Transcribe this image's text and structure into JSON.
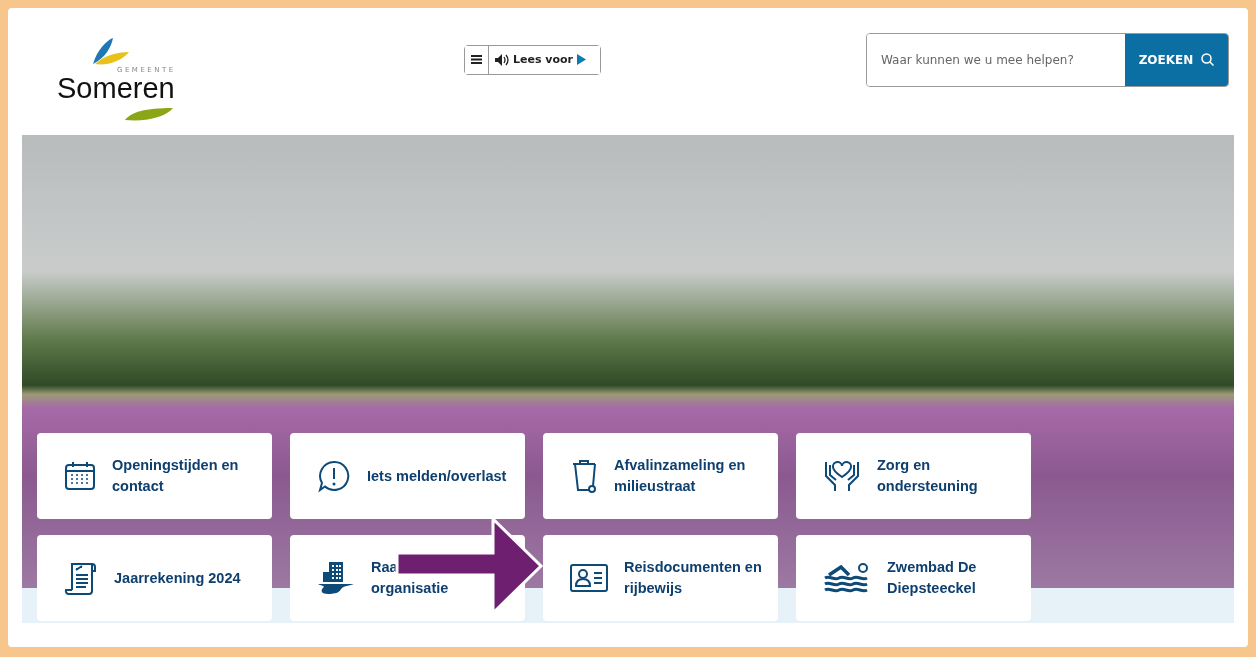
{
  "logo": {
    "small": "GEMEENTE",
    "name": "Someren"
  },
  "toolbar": {
    "read_aloud": "Lees voor"
  },
  "search": {
    "placeholder": "Waar kunnen we u mee helpen?",
    "button": "ZOEKEN"
  },
  "tiles": [
    {
      "kind": "calendar",
      "lines": [
        "Openingstijden en",
        "contact"
      ]
    },
    {
      "kind": "alert",
      "lines": [
        "Iets melden/overlast"
      ]
    },
    {
      "kind": "bin",
      "lines": [
        "Afvalinzameling en",
        "milieustraat"
      ]
    },
    {
      "kind": "care",
      "lines": [
        "Zorg en",
        "ondersteuning"
      ]
    },
    {
      "kind": "receipt",
      "lines": [
        "Jaarrekening 2024"
      ]
    },
    {
      "kind": "townhall",
      "lines": [
        "Raa",
        "organisatie"
      ]
    },
    {
      "kind": "idcard",
      "lines": [
        "Reisdocumenten en",
        "rijbewijs"
      ]
    },
    {
      "kind": "swim",
      "lines": [
        "Zwembad De",
        "Diepsteeckel"
      ]
    }
  ]
}
